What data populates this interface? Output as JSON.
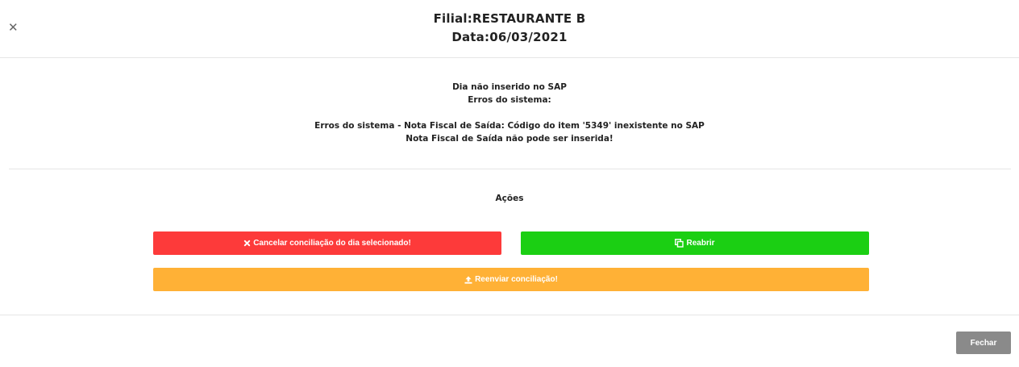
{
  "header": {
    "close_icon": "close-icon",
    "branch_line": "Filial:RESTAURANTE B",
    "date_line": "Data:06/03/2021"
  },
  "messages": {
    "line1": "Dia não inserido no SAP",
    "line2": "Erros do sistema:",
    "line3": "Erros do sistema - Nota Fiscal de Saída: Código do item '5349' inexistente no SAP",
    "line4": "Nota Fiscal de Saída não pode ser inserida!"
  },
  "actions": {
    "title": "Ações",
    "cancel": {
      "label": "Cancelar conciliação do dia selecionado!",
      "icon": "times-icon",
      "color": "#fd3a3a"
    },
    "reopen": {
      "label": "Reabrir",
      "icon": "copy-icon",
      "color": "#1bcf13"
    },
    "resend": {
      "label": "Reenviar conciliação!",
      "icon": "upload-icon",
      "color": "#ffb136"
    }
  },
  "footer": {
    "close_label": "Fechar",
    "close_color": "#8a8a8a"
  }
}
